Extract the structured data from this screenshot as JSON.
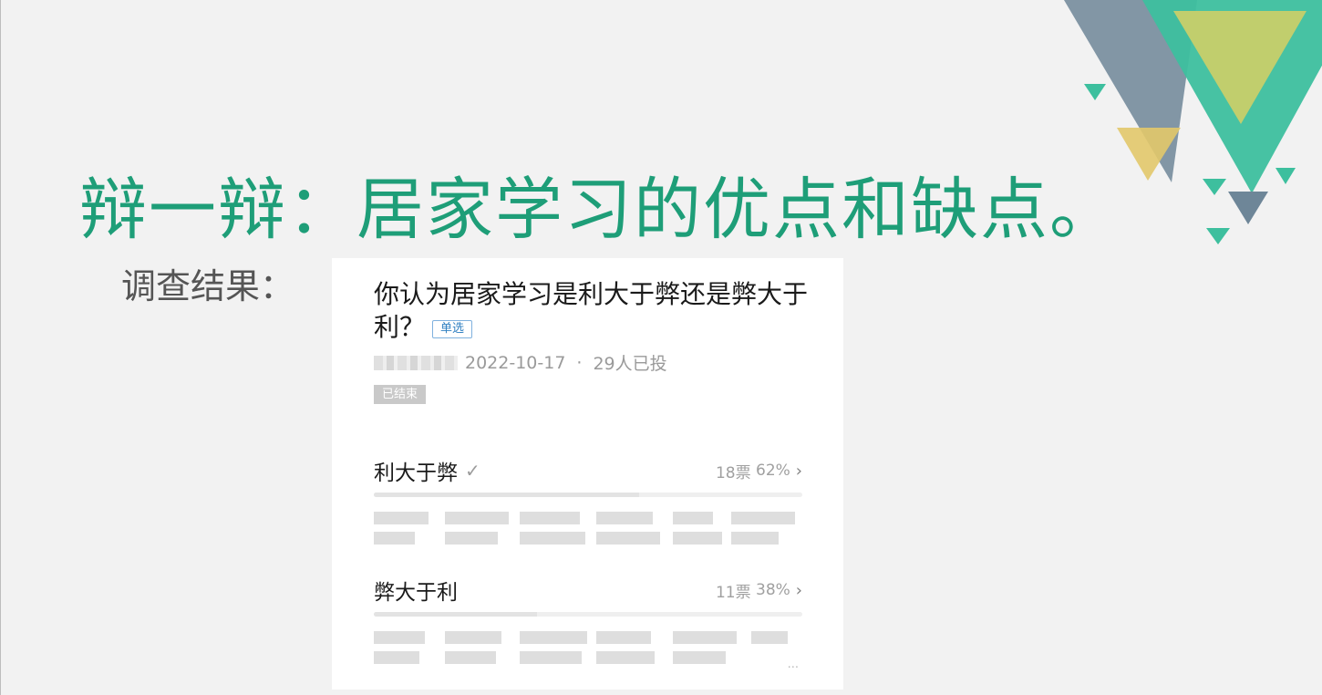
{
  "slide": {
    "title": "辩一辩：居家学习的优点和缺点。",
    "subtitle": "调查结果：",
    "accent_color": "#1e9e78"
  },
  "poll": {
    "question": "你认为居家学习是利大于弊还是弊大于利？",
    "type_tag": "单选",
    "date": "2022-10-17",
    "voted_count_text": "29人已投",
    "status": "已结束",
    "options": [
      {
        "label": "利大于弊",
        "votes_text": "18票",
        "percent_text": "62%",
        "percent": 62,
        "selected": true
      },
      {
        "label": "弊大于利",
        "votes_text": "11票",
        "percent_text": "38%",
        "percent": 38,
        "selected": false
      }
    ],
    "more_text": "..."
  },
  "icons": {
    "selected_check": "check-icon",
    "option_detail": "chevron-right-icon"
  }
}
